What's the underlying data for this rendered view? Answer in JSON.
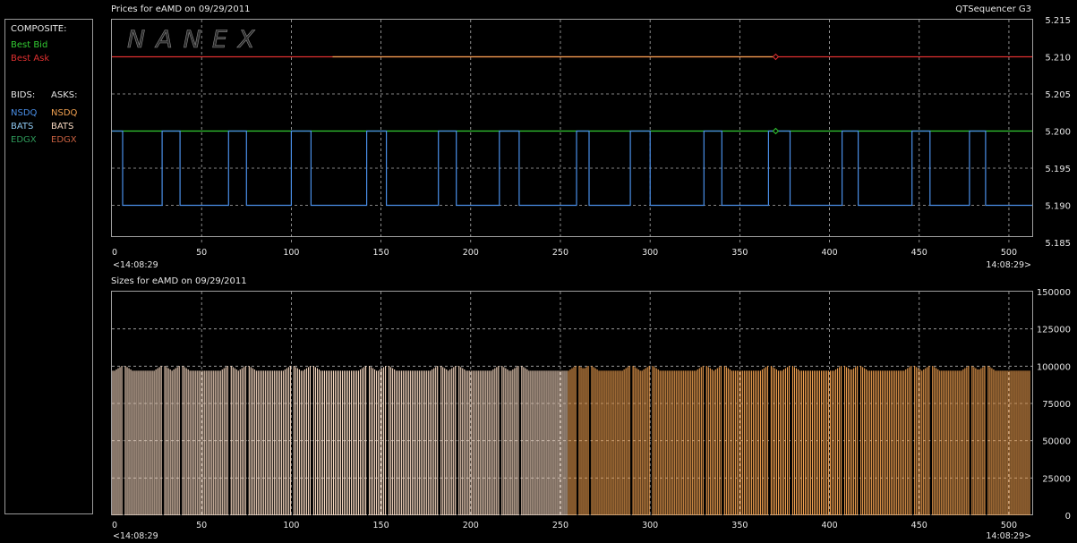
{
  "window": {
    "app_title": "QTSequencer G3"
  },
  "legend": {
    "composite_header": "COMPOSITE:",
    "composite": [
      {
        "label": "Best Bid",
        "color": "#33cc33"
      },
      {
        "label": "Best Ask",
        "color": "#e03030"
      }
    ],
    "bids_header": "BIDS:",
    "asks_header": "ASKS:",
    "bids": [
      {
        "label": "NSDQ",
        "color": "#4a8fe8"
      },
      {
        "label": "BATS",
        "color": "#8ec8f0"
      },
      {
        "label": "EDGX",
        "color": "#2e9a5a"
      }
    ],
    "asks": [
      {
        "label": "NSDQ",
        "color": "#f0a050"
      },
      {
        "label": "BATS",
        "color": "#f7d8c0"
      },
      {
        "label": "EDGX",
        "color": "#c86040"
      }
    ]
  },
  "chart_data": [
    {
      "type": "line",
      "title": "Prices for  eAMD  on  09/29/2011",
      "watermark": "NANEX",
      "x_ticks": [
        0,
        50,
        100,
        150,
        200,
        250,
        300,
        350,
        400,
        450,
        500
      ],
      "xlim": [
        0,
        513
      ],
      "time_start": "<14:08:29",
      "time_end": "14:08:29>",
      "ylim": [
        5.185,
        5.215
      ],
      "y_ticks": [
        "5.215",
        "5.210",
        "5.205",
        "5.200",
        "5.195",
        "5.190",
        "5.185"
      ],
      "series": [
        {
          "name": "Best Ask",
          "color": "#e03030",
          "x": [
            0,
            513
          ],
          "y": [
            5.21,
            5.21
          ]
        },
        {
          "name": "NSDQ",
          "color": "#f0a050",
          "x": [
            123,
            370
          ],
          "y": [
            5.21,
            5.21
          ]
        },
        {
          "name": "Best Bid",
          "color": "#33cc33",
          "x": [
            0,
            513
          ],
          "y": [
            5.2,
            5.2
          ]
        },
        {
          "name": "NSDQ",
          "color": "#4a8fe8",
          "x": [
            0,
            6,
            6,
            28,
            28,
            38,
            38,
            65,
            65,
            75,
            75,
            100,
            100,
            111,
            111,
            142,
            142,
            153,
            153,
            182,
            182,
            192,
            192,
            216,
            216,
            227,
            227,
            259,
            259,
            266,
            266,
            289,
            289,
            300,
            300,
            330,
            330,
            340,
            340,
            366,
            366,
            378,
            378,
            407,
            407,
            416,
            416,
            446,
            446,
            456,
            456,
            478,
            478,
            487,
            487,
            513
          ],
          "y": [
            5.2,
            5.2,
            5.19,
            5.19,
            5.2,
            5.2,
            5.19,
            5.19,
            5.2,
            5.2,
            5.19,
            5.19,
            5.2,
            5.2,
            5.19,
            5.19,
            5.2,
            5.2,
            5.19,
            5.19,
            5.2,
            5.2,
            5.19,
            5.19,
            5.2,
            5.2,
            5.19,
            5.19,
            5.2,
            5.2,
            5.19,
            5.19,
            5.2,
            5.2,
            5.19,
            5.19,
            5.2,
            5.2,
            5.19,
            5.19,
            5.2,
            5.2,
            5.19,
            5.19,
            5.2,
            5.2,
            5.19,
            5.19,
            5.2,
            5.2,
            5.19,
            5.19,
            5.2,
            5.2,
            5.19,
            5.19
          ]
        }
      ],
      "markers": [
        {
          "x": 370,
          "y": 5.21,
          "color": "#e03030"
        },
        {
          "x": 370,
          "y": 5.2,
          "color": "#33cc33"
        }
      ]
    },
    {
      "type": "bar",
      "title": "Sizes for  eAMD  on  09/29/2011",
      "x_ticks": [
        0,
        50,
        100,
        150,
        200,
        250,
        300,
        350,
        400,
        450,
        500
      ],
      "xlim": [
        0,
        513
      ],
      "time_start": "<14:08:29",
      "time_end": "14:08:29>",
      "ylim": [
        0,
        150000
      ],
      "y_ticks": [
        "150000",
        "125000",
        "100000",
        "75000",
        "50000",
        "25000",
        "0"
      ],
      "series": [
        {
          "name": "BATS",
          "color": "#f7d8c0",
          "x_range": [
            0,
            254
          ]
        },
        {
          "name": "NSDQ",
          "color": "#f0a050",
          "x_range": [
            254,
            512
          ]
        }
      ],
      "approx_bar_value": 97000,
      "approx_peak_value": 101000,
      "gap_positions": [
        6,
        28,
        38,
        65,
        75,
        100,
        111,
        142,
        153,
        182,
        192,
        216,
        227,
        259,
        266,
        289,
        300,
        330,
        340,
        366,
        378,
        407,
        416,
        446,
        456,
        478,
        487
      ]
    }
  ]
}
